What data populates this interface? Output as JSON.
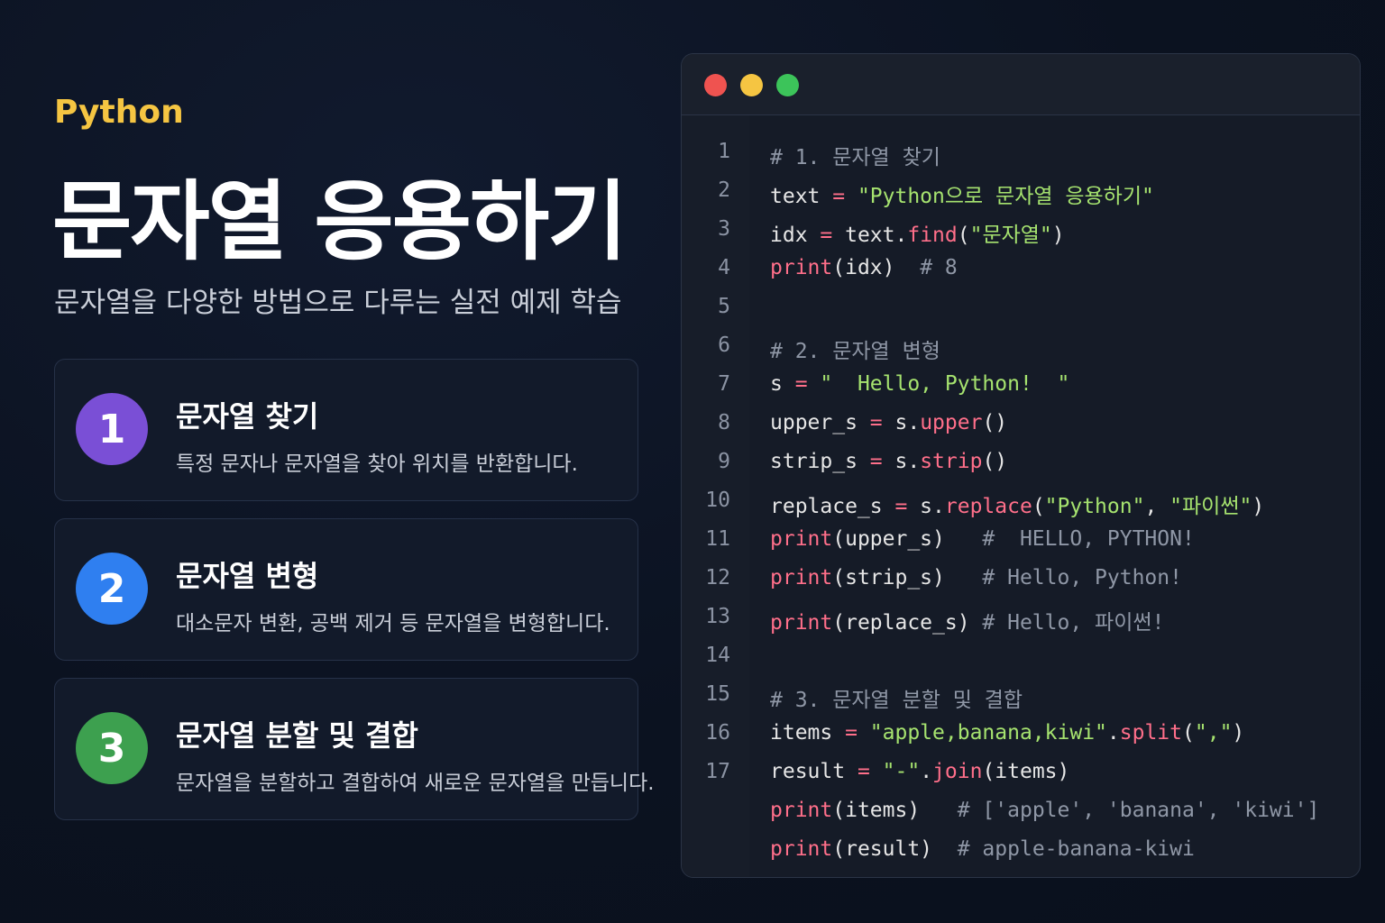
{
  "header": {
    "kicker": "Python",
    "title": "문자열 응용하기",
    "subtitle": "문자열을 다양한 방법으로 다루는 실전 예제 학습"
  },
  "cards": [
    {
      "number": "1",
      "title": "문자열 찾기",
      "desc": "특정 문자나 문자열을 찾아 위치를 반환합니다.",
      "color": "#7a4fd6"
    },
    {
      "number": "2",
      "title": "문자열 변형",
      "desc": "대소문자 변환, 공백 제거 등 문자열을 변형합니다.",
      "color": "#2f7ff0"
    },
    {
      "number": "3",
      "title": "문자열 분할 및 결합",
      "desc": "문자열을 분할하고 결합하여 새로운 문자열을 만듭니다.",
      "color": "#3da04f"
    }
  ],
  "editor": {
    "window_dots": [
      "#ef5350",
      "#f5c542",
      "#3cc45a"
    ],
    "line_numbers": [
      "1",
      "2",
      "3",
      "4",
      "5",
      "6",
      "7",
      "8",
      "9",
      "10",
      "11",
      "12",
      "13",
      "14",
      "15",
      "16",
      "17"
    ],
    "code": {
      "l1_comment": "# 1. 문자열 찾기",
      "l2_var": "text",
      "l2_eq": " = ",
      "l2_str": "\"Python으로 문자열 응용하기\"",
      "l3_var": "idx",
      "l3_eq": " = ",
      "l3_obj": "text.",
      "l3_fn": "find",
      "l3_open": "(",
      "l3_str": "\"문자열\"",
      "l3_close": ")",
      "l4_fn": "print",
      "l4_args": "(idx)  ",
      "l4_comment": "# 8",
      "l6_comment": "# 2. 문자열 변형",
      "l7_var": "s",
      "l7_eq": " = ",
      "l7_str": "\"  Hello, Python!  \"",
      "l8_var": "upper_s",
      "l8_eq": " = ",
      "l8_obj": "s.",
      "l8_fn": "upper",
      "l8_args": "()",
      "l9_var": "strip_s",
      "l9_eq": " = ",
      "l9_obj": "s.",
      "l9_fn": "strip",
      "l9_args": "()",
      "l10_var": "replace_s",
      "l10_eq": " = ",
      "l10_obj": "s.",
      "l10_fn": "replace",
      "l10_open": "(",
      "l10_str1": "\"Python\"",
      "l10_sep": ", ",
      "l10_str2": "\"파이썬\"",
      "l10_close": ")",
      "l11_fn": "print",
      "l11_args": "(upper_s)   ",
      "l11_comment": "#  HELLO, PYTHON!",
      "l12_fn": "print",
      "l12_args": "(strip_s)   ",
      "l12_comment": "# Hello, Python!",
      "l13_fn": "print",
      "l13_args": "(replace_s) ",
      "l13_comment": "# Hello, 파이썬!",
      "l15_comment": "# 3. 문자열 분할 및 결합",
      "l16_var": "items",
      "l16_eq": " = ",
      "l16_str": "\"apple,banana,kiwi\"",
      "l16_dot": ".",
      "l16_fn": "split",
      "l16_open": "(",
      "l16_arg": "\",\"",
      "l16_close": ")",
      "l17_var": "result",
      "l17_eq": " = ",
      "l17_str": "\"-\"",
      "l17_dot": ".",
      "l17_fn": "join",
      "l17_args": "(items)",
      "l18_fn": "print",
      "l18_args": "(items)   ",
      "l18_comment": "# ['apple', 'banana', 'kiwi']",
      "l19_fn": "print",
      "l19_args": "(result)  ",
      "l19_comment": "# apple-banana-kiwi"
    }
  }
}
